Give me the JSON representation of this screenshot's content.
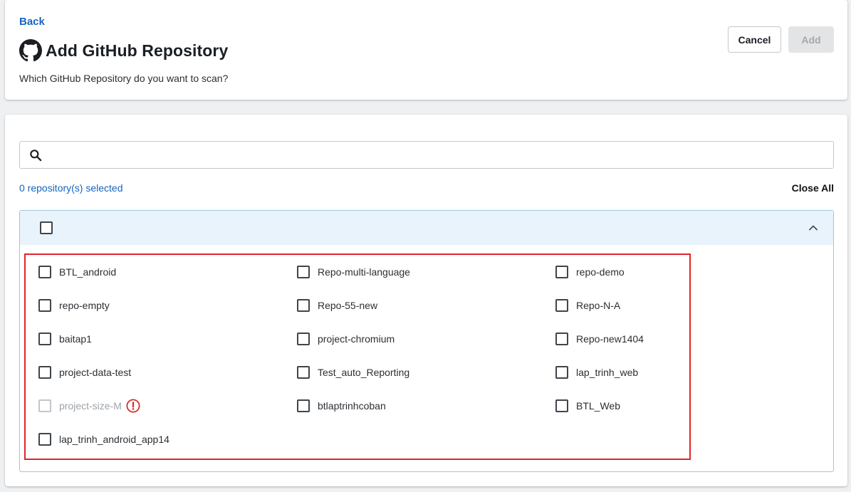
{
  "header": {
    "back_label": "Back",
    "title": "Add GitHub Repository",
    "subtitle": "Which GitHub Repository do you want to scan?",
    "cancel_label": "Cancel",
    "add_label": "Add"
  },
  "search": {
    "value": "",
    "placeholder": ""
  },
  "selection": {
    "count_text": "0 repository(s) selected",
    "close_all_label": "Close All"
  },
  "group": {
    "name": "",
    "expanded": true
  },
  "repos": [
    {
      "label": "BTL_android",
      "disabled": false
    },
    {
      "label": "Repo-multi-language",
      "disabled": false
    },
    {
      "label": "repo-demo",
      "disabled": false
    },
    {
      "label": "repo-empty",
      "disabled": false
    },
    {
      "label": "Repo-55-new",
      "disabled": false
    },
    {
      "label": "Repo-N-A",
      "disabled": false
    },
    {
      "label": "baitap1",
      "disabled": false
    },
    {
      "label": "project-chromium",
      "disabled": false
    },
    {
      "label": "Repo-new1404",
      "disabled": false
    },
    {
      "label": "project-data-test",
      "disabled": false
    },
    {
      "label": "Test_auto_Reporting",
      "disabled": false
    },
    {
      "label": "lap_trinh_web",
      "disabled": false
    },
    {
      "label": "project-size-M",
      "disabled": true
    },
    {
      "label": "btlaptrinhcoban",
      "disabled": false
    },
    {
      "label": "BTL_Web",
      "disabled": false
    },
    {
      "label": "lap_trinh_android_app14",
      "disabled": false
    }
  ],
  "colors": {
    "link": "#1565c0",
    "highlight_border": "#e0262b",
    "warning": "#d32f2f",
    "group_header_bg": "#e8f3fc"
  },
  "icons": {
    "title": "github-icon",
    "search": "search-icon",
    "collapse": "chevron-up-icon",
    "warning": "warning-icon"
  }
}
